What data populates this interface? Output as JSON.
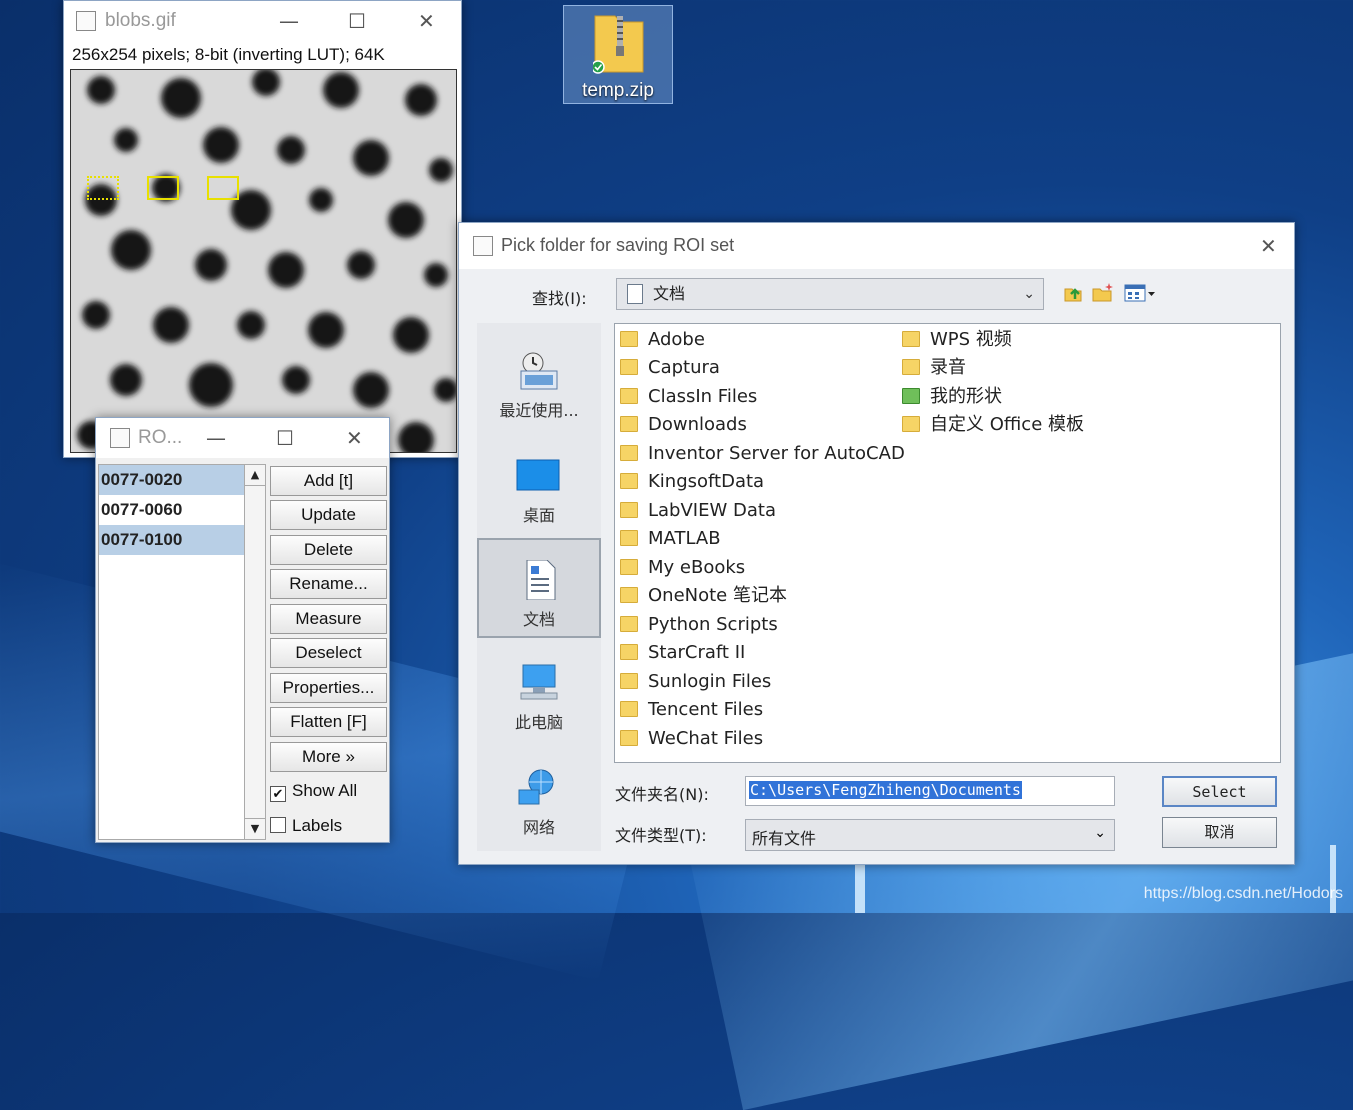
{
  "desktop": {
    "icon_label": "temp.zip",
    "watermark": "https://blog.csdn.net/Hodors"
  },
  "image_window": {
    "title": "blobs.gif",
    "info": "256x254 pixels; 8-bit (inverting LUT); 64K",
    "minimize_glyph": "—",
    "maximize_glyph": "☐",
    "close_glyph": "✕"
  },
  "roi_manager": {
    "title": "RO...",
    "minimize_glyph": "—",
    "maximize_glyph": "☐",
    "close_glyph": "✕",
    "items": [
      {
        "label": "0077-0020",
        "selected": true
      },
      {
        "label": "0077-0060",
        "selected": false
      },
      {
        "label": "0077-0100",
        "selected": true
      }
    ],
    "buttons": [
      "Add [t]",
      "Update",
      "Delete",
      "Rename...",
      "Measure",
      "Deselect",
      "Properties...",
      "Flatten [F]",
      "More »"
    ],
    "show_all_label": "Show All",
    "show_all_checked": true,
    "labels_label": "Labels",
    "labels_checked": false
  },
  "folder_dialog": {
    "title": "Pick folder for saving ROI set",
    "close_glyph": "✕",
    "look_in_label": "查找(I):",
    "look_in_value": "文档",
    "places": [
      "最近使用...",
      "桌面",
      "文档",
      "此电脑",
      "网络"
    ],
    "selected_place": "文档",
    "folders_col1": [
      "Adobe",
      "Captura",
      "ClassIn Files",
      "Downloads",
      "Inventor Server for AutoCAD",
      "KingsoftData",
      "LabVIEW Data",
      "MATLAB",
      "My eBooks",
      "OneNote 笔记本",
      "Python Scripts",
      "StarCraft II",
      "Sunlogin Files",
      "Tencent Files",
      "WeChat Files"
    ],
    "folders_col2": [
      "WPS 视频",
      "录音",
      "我的形状",
      "自定义 Office 模板"
    ],
    "folder_name_label": "文件夹名(N):",
    "folder_name_value": "C:\\Users\\FengZhiheng\\Documents",
    "file_type_label": "文件类型(T):",
    "file_type_value": "所有文件",
    "select_button": "Select",
    "cancel_button": "取消"
  }
}
